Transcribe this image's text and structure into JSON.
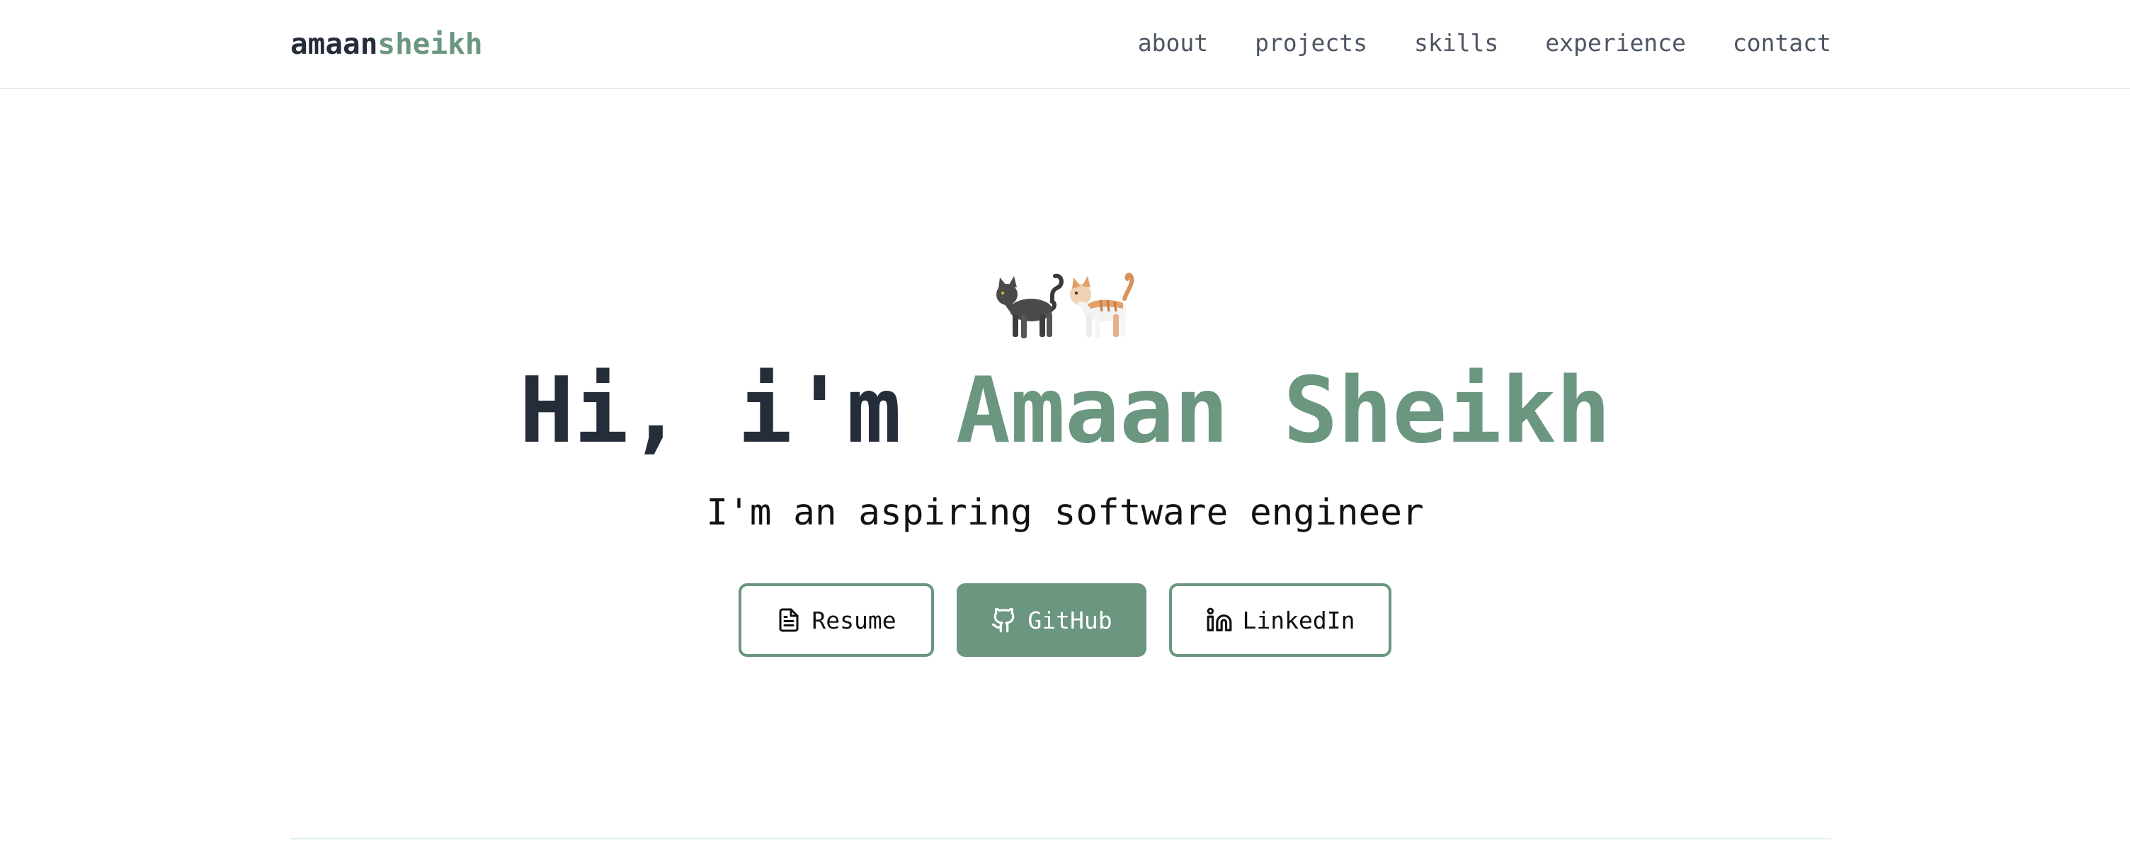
{
  "nav": {
    "logo_first": "amaan",
    "logo_second": "sheikh",
    "links": [
      "about",
      "projects",
      "skills",
      "experience",
      "contact"
    ]
  },
  "hero": {
    "emoji": [
      "black-cat-icon",
      "orange-cat-icon"
    ],
    "greeting": "Hi, i'm ",
    "name": "Amaan Sheikh",
    "subtitle": "I'm an aspiring software engineer",
    "buttons": {
      "resume": "Resume",
      "github": "GitHub",
      "linkedin": "LinkedIn"
    }
  },
  "colors": {
    "accent": "#6b9680",
    "dark": "#252d3b",
    "nav_text": "#4b5563",
    "divider": "#e3f1ec"
  }
}
